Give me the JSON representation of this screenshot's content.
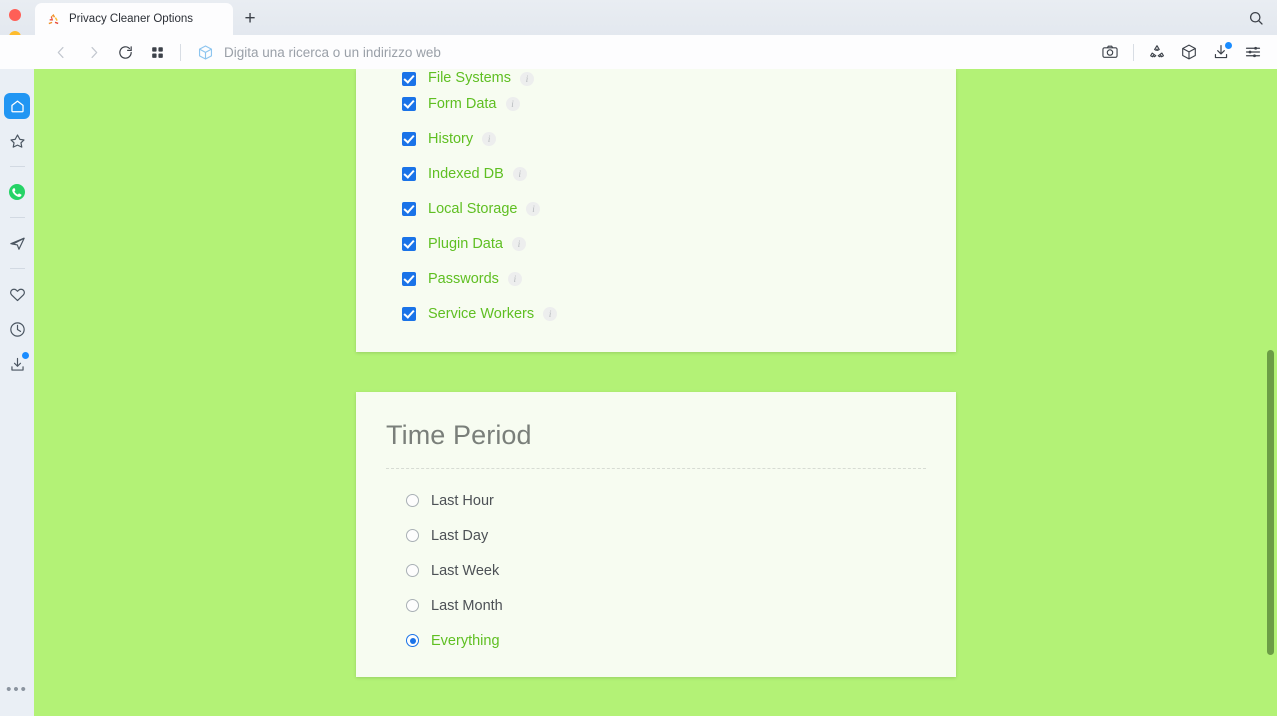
{
  "browser": {
    "window_controls": [
      "close",
      "minimize",
      "maximize"
    ],
    "tab": {
      "title": "Privacy Cleaner Options",
      "favicon": "recycle-icon"
    },
    "new_tab_label": "+",
    "tab_search_icon": "search-icon",
    "nav": {
      "back_icon": "chevron-left-icon",
      "forward_icon": "chevron-right-icon",
      "reload_icon": "reload-icon",
      "speeddial_icon": "grid-icon"
    },
    "address_bar": {
      "icon": "cube-icon",
      "placeholder": "Digita una ricerca o un indirizzo web",
      "value": ""
    },
    "right_actions": [
      {
        "name": "snapshot-icon",
        "label": "Snapshot"
      },
      {
        "name": "recycle-icon",
        "label": "Recycle"
      },
      {
        "name": "cube-icon",
        "label": "Workspaces"
      },
      {
        "name": "download-icon",
        "label": "Downloads",
        "badge": true
      },
      {
        "name": "easy-setup-icon",
        "label": "Easy Setup"
      }
    ]
  },
  "sidebar": {
    "items": [
      {
        "name": "sidebar-item-home",
        "icon": "home-icon",
        "active": true
      },
      {
        "name": "sidebar-item-speeddial",
        "icon": "star-icon",
        "active": false
      },
      {
        "name": "sidebar-item-whatsapp",
        "icon": "whatsapp-icon",
        "active": false
      },
      {
        "name": "sidebar-item-telegram",
        "icon": "telegram-icon",
        "active": false
      },
      {
        "name": "sidebar-item-favorites",
        "icon": "heart-icon",
        "active": false
      },
      {
        "name": "sidebar-item-history",
        "icon": "clock-icon",
        "active": false
      },
      {
        "name": "sidebar-item-downloads",
        "icon": "download-tray-icon",
        "active": false,
        "badge": true
      }
    ],
    "more_label": "•••"
  },
  "page": {
    "background_color": "#b3f276",
    "card_color": "#f7fcf1",
    "accent_green": "#5fbf22",
    "accent_blue": "#1a73e8",
    "data_types_card": {
      "items": [
        {
          "label": "File Systems",
          "checked": true,
          "info": "i",
          "clipped": true
        },
        {
          "label": "Form Data",
          "checked": true,
          "info": "i",
          "clipped": false
        },
        {
          "label": "History",
          "checked": true,
          "info": "i",
          "clipped": false
        },
        {
          "label": "Indexed DB",
          "checked": true,
          "info": "i",
          "clipped": false
        },
        {
          "label": "Local Storage",
          "checked": true,
          "info": "i",
          "clipped": false
        },
        {
          "label": "Plugin Data",
          "checked": true,
          "info": "i",
          "clipped": false
        },
        {
          "label": "Passwords",
          "checked": true,
          "info": "i",
          "clipped": false
        },
        {
          "label": "Service Workers",
          "checked": true,
          "info": "i",
          "clipped": false
        }
      ]
    },
    "time_period_card": {
      "title": "Time Period",
      "options": [
        {
          "label": "Last Hour",
          "selected": false
        },
        {
          "label": "Last Day",
          "selected": false
        },
        {
          "label": "Last Week",
          "selected": false
        },
        {
          "label": "Last Month",
          "selected": false
        },
        {
          "label": "Everything",
          "selected": true
        }
      ]
    }
  },
  "scrollbar": {
    "orientation": "vertical",
    "thumb_color": "#5d8a3c"
  }
}
